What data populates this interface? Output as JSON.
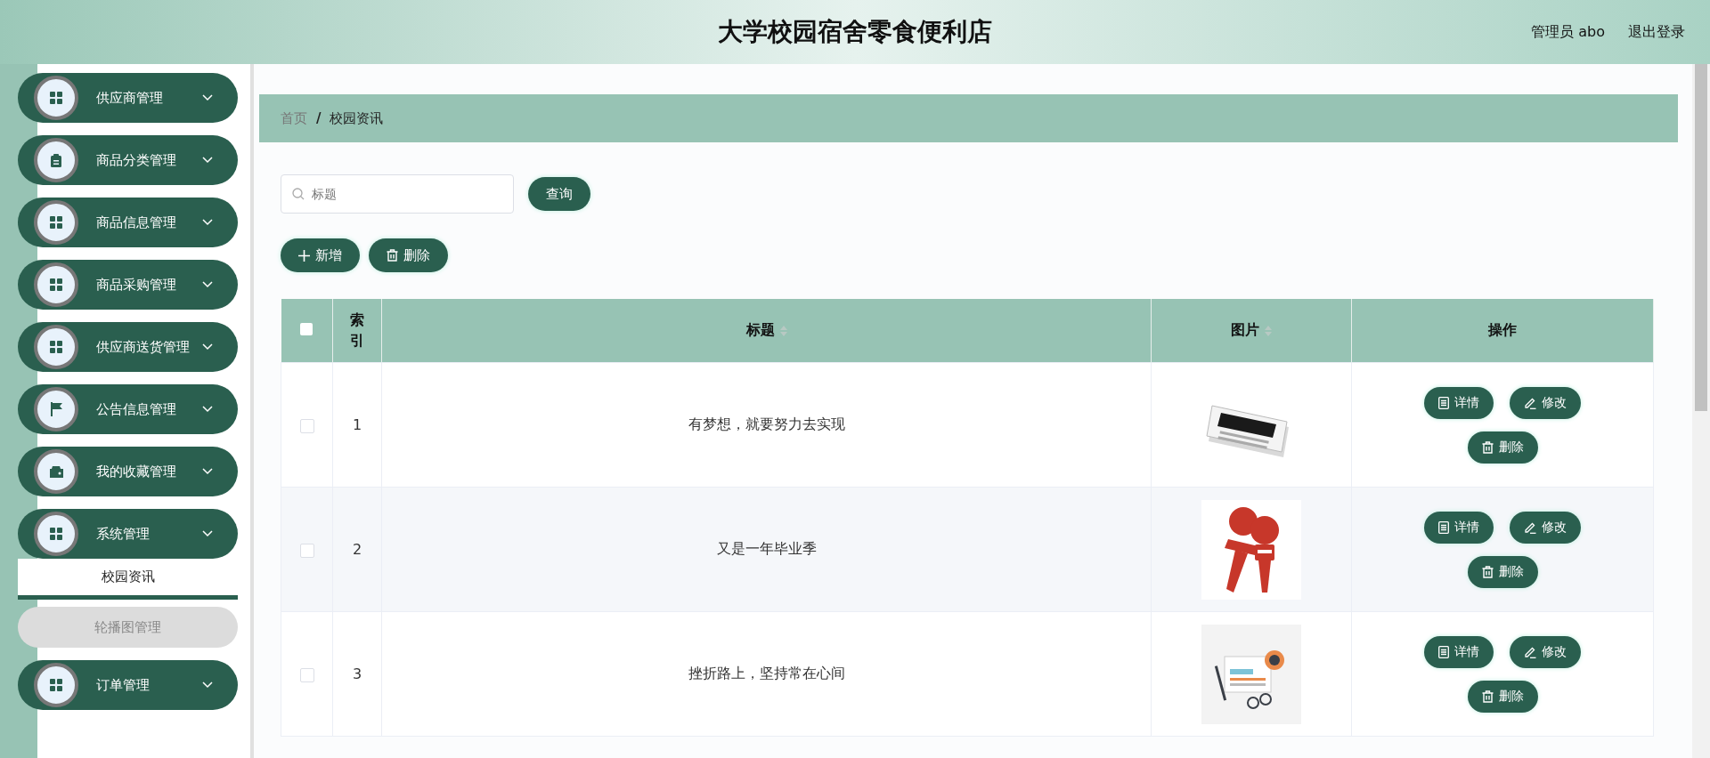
{
  "header": {
    "title": "大学校园宿舍零食便利店",
    "user": "管理员 abo",
    "logout": "退出登录"
  },
  "sidebar": {
    "items": [
      {
        "label": "供应商管理",
        "kind": "grid"
      },
      {
        "label": "商品分类管理",
        "kind": "clipboard"
      },
      {
        "label": "商品信息管理",
        "kind": "grid"
      },
      {
        "label": "商品采购管理",
        "kind": "grid"
      },
      {
        "label": "供应商送货管理",
        "kind": "grid"
      },
      {
        "label": "公告信息管理",
        "kind": "flag"
      },
      {
        "label": "我的收藏管理",
        "kind": "wallet"
      },
      {
        "label": "系统管理",
        "kind": "grid",
        "children": [
          {
            "label": "校园资讯",
            "selected": true
          },
          {
            "label": "轮播图管理",
            "selected": false
          }
        ]
      },
      {
        "label": "订单管理",
        "kind": "grid"
      }
    ]
  },
  "breadcrumb": {
    "separator": "/",
    "items": [
      {
        "label": "首页",
        "selected": false
      },
      {
        "label": "校园资讯",
        "selected": true
      }
    ]
  },
  "search": {
    "placeholder": "标题",
    "button": "查询"
  },
  "actions": [
    {
      "label": "新增",
      "kind": "plus"
    },
    {
      "label": "删除",
      "kind": "trash"
    }
  ],
  "table": {
    "header_checked": false,
    "columns": [
      {
        "kind": "checkbox"
      },
      {
        "kind": "text",
        "label": "索引"
      },
      {
        "kind": "text",
        "label": "标题",
        "sortable": true
      },
      {
        "kind": "text",
        "label": "图片",
        "sortable": true
      },
      {
        "kind": "text",
        "label": "操作"
      }
    ],
    "rows": [
      {
        "checked": false,
        "index": "1",
        "title": "有梦想，就要努力去实现",
        "actions": [
          {
            "label": "详情",
            "kind": "doc"
          },
          {
            "label": "修改",
            "kind": "pencil"
          },
          {
            "label": "删除",
            "kind": "trash"
          }
        ]
      },
      {
        "checked": false,
        "index": "2",
        "title": "又是一年毕业季",
        "actions": [
          {
            "label": "详情",
            "kind": "doc"
          },
          {
            "label": "修改",
            "kind": "pencil"
          },
          {
            "label": "删除",
            "kind": "trash"
          }
        ]
      },
      {
        "checked": false,
        "index": "3",
        "title": "挫折路上，坚持常在心间",
        "actions": [
          {
            "label": "详情",
            "kind": "doc"
          },
          {
            "label": "修改",
            "kind": "pencil"
          },
          {
            "label": "删除",
            "kind": "trash"
          }
        ]
      }
    ]
  }
}
